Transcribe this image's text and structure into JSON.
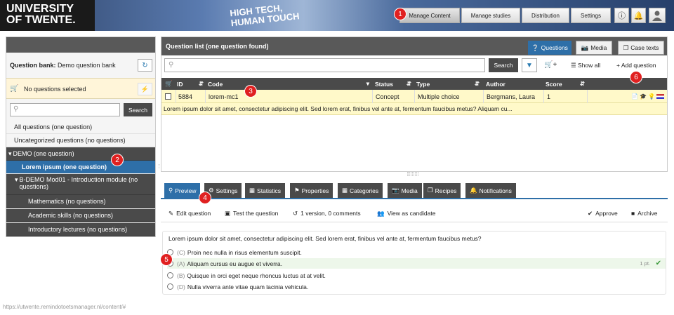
{
  "header": {
    "logo_line1": "UNIVERSITY",
    "logo_line2": "OF TWENTE.",
    "banner_line1": "HIGH TECH,",
    "banner_line2": "HUMAN TOUCH",
    "nav": [
      "Manage Content",
      "Manage studies",
      "Distribution",
      "Settings"
    ],
    "icons": [
      "info-icon",
      "bell-icon",
      "user-icon"
    ]
  },
  "left": {
    "question_bank_label": "Question bank:",
    "question_bank_value": "Demo question bank",
    "selection_text": "No questions selected",
    "search_placeholder": "",
    "search_button": "Search",
    "tree": [
      {
        "label": "All questions (one question)"
      },
      {
        "label": "Uncategorized questions (no questions)"
      },
      {
        "label": "DEMO (one question)"
      },
      {
        "label": "Lorem ipsum (one question)"
      },
      {
        "label": "B-DEMO Mod01 - Introduction module (no"
      },
      {
        "label": "questions)"
      },
      {
        "label": "Mathematics (no questions)"
      },
      {
        "label": "Academic skills (no questions)"
      },
      {
        "label": "Introductory lectures (no questions)"
      }
    ]
  },
  "qlist": {
    "title": "Question list",
    "count": "(one question found)",
    "tabs": [
      "Questions",
      "Media",
      "Case texts"
    ],
    "search_button": "Search",
    "show_all": "Show all",
    "add_question": "Add question",
    "columns": [
      "ID",
      "Code",
      "Status",
      "Type",
      "Author",
      "Score"
    ],
    "row": {
      "id": "5884",
      "code": "lorem-mc1",
      "status": "Concept",
      "type": "Multiple choice",
      "author": "Bergmans, Laura",
      "score": "1"
    },
    "row_text": "Lorem ipsum dolor sit amet, consectetur adipiscing elit. Sed lorem erat, finibus vel ante at, fermentum faucibus metus? Aliquam cu..."
  },
  "preview": {
    "tabs": [
      "Preview",
      "Settings",
      "Statistics",
      "Properties",
      "Categories",
      "Media",
      "Recipes",
      "Notifications"
    ],
    "actions": {
      "edit": "Edit question",
      "test": "Test the question",
      "versions": "1 version, 0 comments",
      "candidate": "View as candidate",
      "approve": "Approve",
      "archive": "Archive"
    },
    "question": "Lorem ipsum dolor sit amet, consectetur adipiscing elit. Sed lorem erat, finibus vel ante at, fermentum faucibus metus?",
    "answers": [
      {
        "letter": "(C)",
        "text": "Proin nec nulla in risus elementum suscipit.",
        "points": ""
      },
      {
        "letter": "(A)",
        "text": "Aliquam cursus eu augue et viverra.",
        "points": "1 pt."
      },
      {
        "letter": "(B)",
        "text": "Quisque in orci eget neque rhoncus luctus at at velit.",
        "points": ""
      },
      {
        "letter": "(D)",
        "text": "Nulla viverra ante vitae quam lacinia vehicula.",
        "points": ""
      }
    ]
  },
  "status_url": "https://utwente.remindotoetsmanager.nl/content/#",
  "callouts": [
    "1",
    "2",
    "3",
    "4",
    "5",
    "6"
  ],
  "colors": {
    "accent_blue": "#2e6fa8",
    "callout_red": "#e02020",
    "highlight_yellow": "#fff9c9"
  }
}
